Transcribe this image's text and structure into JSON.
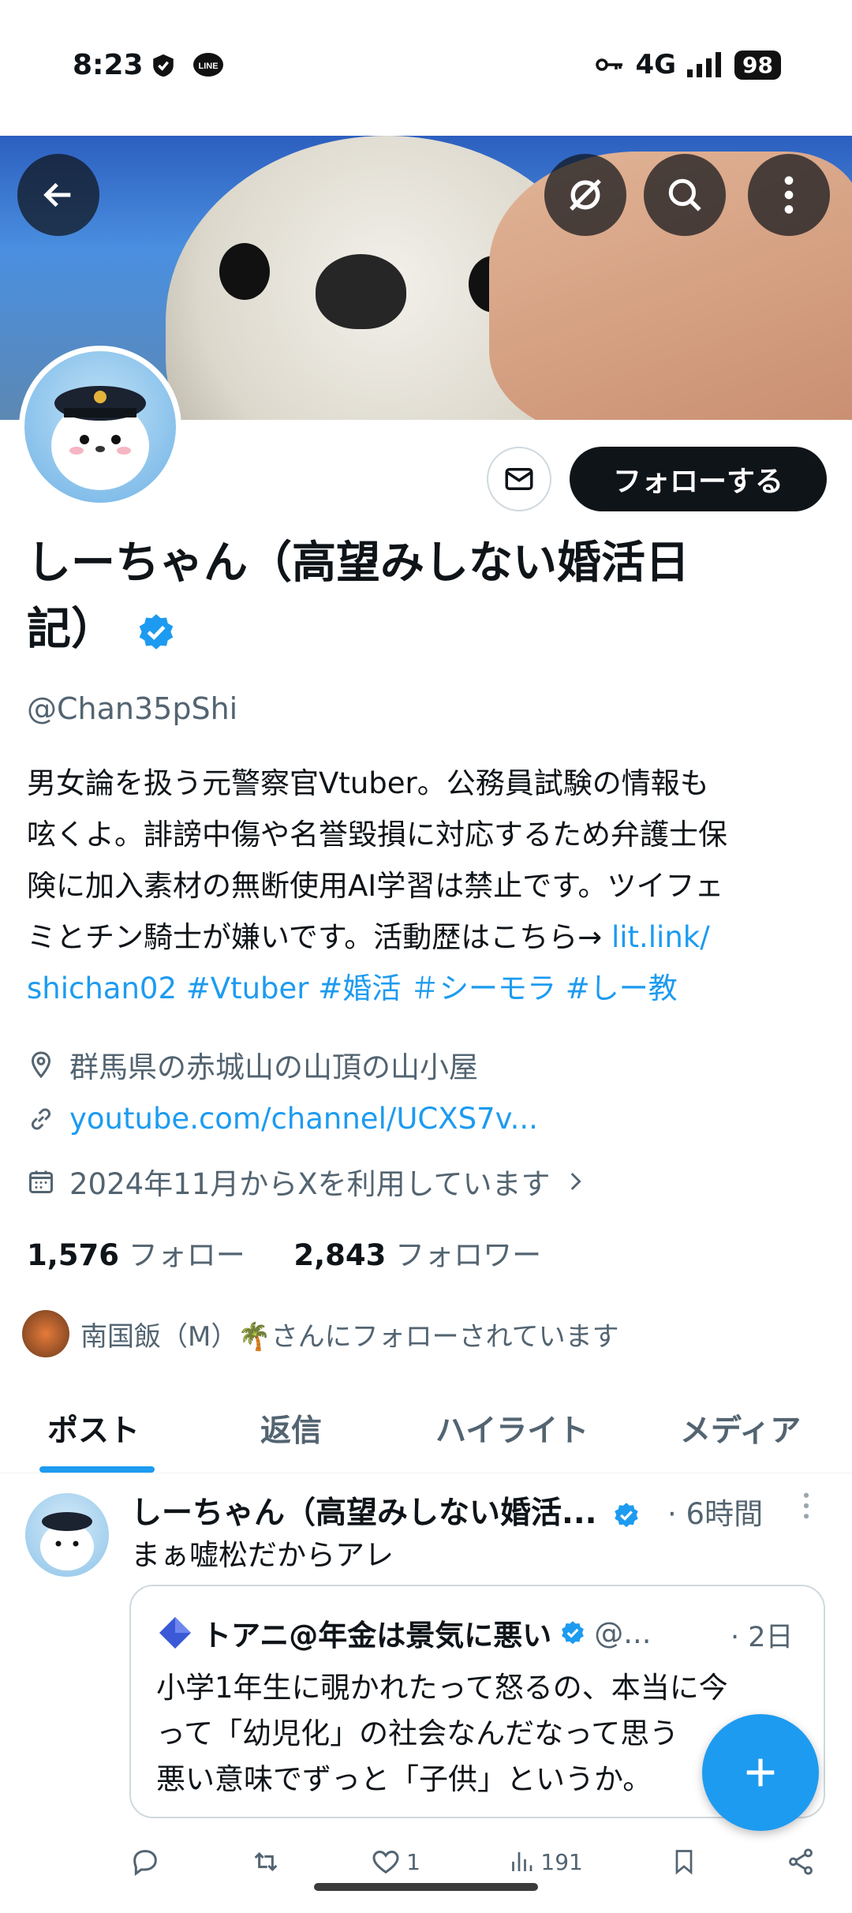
{
  "status_bar": {
    "time": "8:23",
    "network": "4G",
    "battery": "98"
  },
  "profile": {
    "name_line1": "しーちゃん（高望みしない婚活日",
    "name_line2": "記）",
    "handle": "@Chan35pShi",
    "follow_label": "フォローする",
    "bio": {
      "line1": "男女論を扱う元警察官Vtuber。公務員試験の情報も",
      "line2": "呟くよ。誹謗中傷や名誉毀損に対応するため弁護士保",
      "line3": "険に加入素材の無断使用AI学習は禁止です。ツイフェ",
      "line4_text": "ミとチン騎士が嫌いです。活動歴はこちら→ ",
      "line4_link": "lit.link/",
      "line5_link": "shichan02",
      "hashtags": "#Vtuber #婚活 ＃シーモラ #しー教"
    },
    "location": "群馬県の赤城山の山頂の山小屋",
    "website": "youtube.com/channel/UCXS7v...",
    "joined": "2024年11月からXを利用しています",
    "following_count": "1,576",
    "following_label": "フォロー",
    "followers_count": "2,843",
    "followers_label": "フォロワー",
    "followed_by": "南国飯（M）🌴さんにフォローされています"
  },
  "tabs": [
    {
      "label": "ポスト",
      "active": true
    },
    {
      "label": "返信",
      "active": false
    },
    {
      "label": "ハイライト",
      "active": false
    },
    {
      "label": "メディア",
      "active": false
    }
  ],
  "post": {
    "author": "しーちゃん（高望みしない婚活...",
    "time": "· 6時間",
    "text": "まぁ嘘松だからアレ",
    "quote": {
      "author": "トアニ@年金は景気に悪い",
      "handle": "@...",
      "time": "· 2日",
      "line1": "小学1年生に覗かれたって怒るの、本当に今",
      "line2": "って「幼児化」の社会なんだなって思う",
      "line3": "悪い意味でずっと「子供」というか。"
    },
    "like_count": "1",
    "view_count": "191"
  },
  "colors": {
    "accent": "#1d9bf0",
    "text": "#0f1419",
    "secondary": "#536471"
  }
}
